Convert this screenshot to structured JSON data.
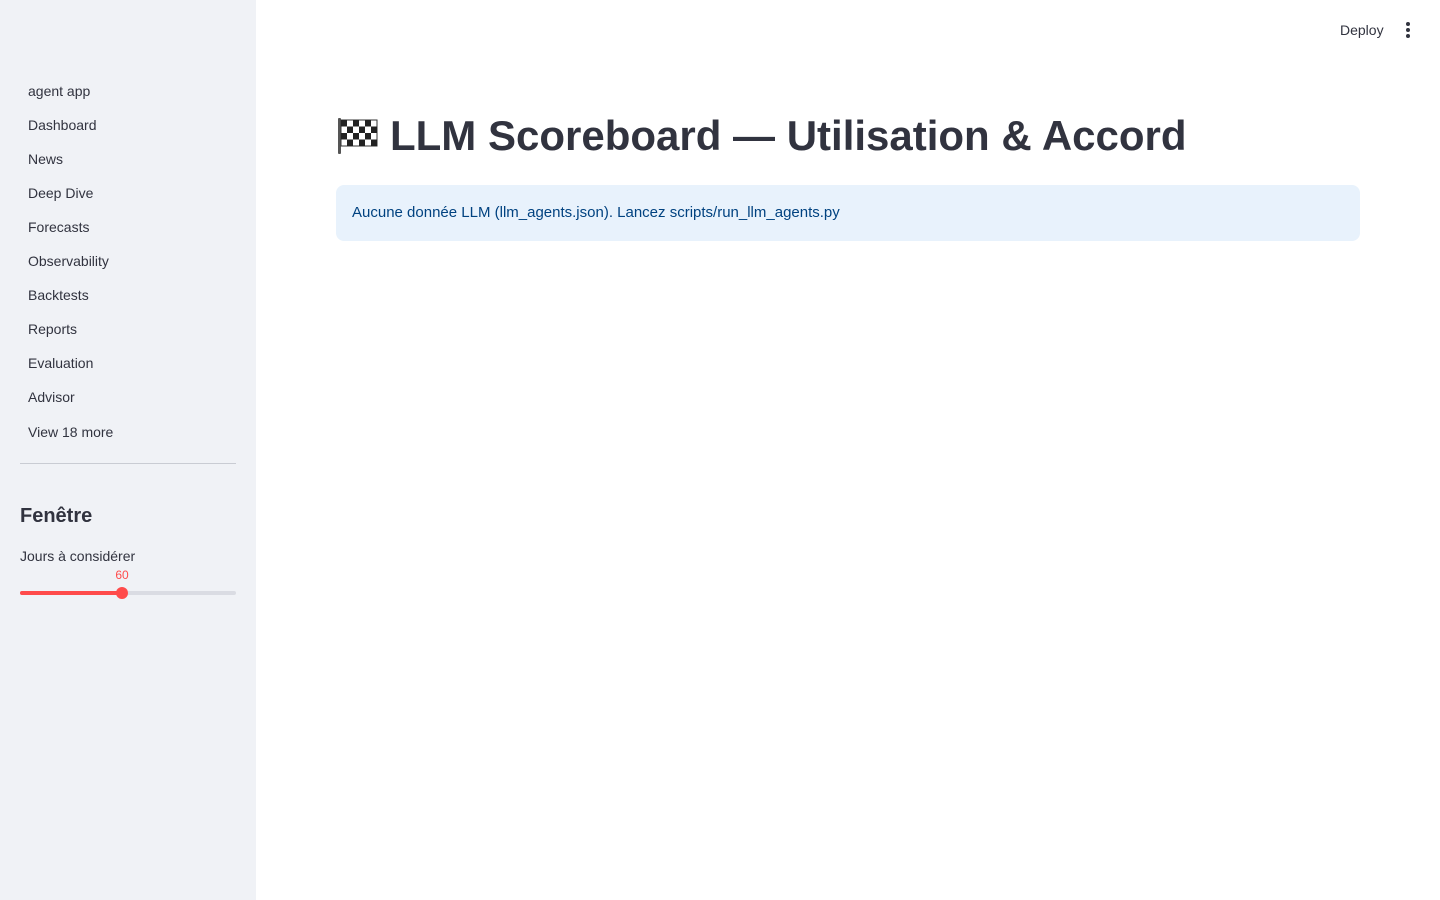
{
  "header": {
    "deploy_label": "Deploy",
    "menu_icon": "more-vert-icon"
  },
  "sidebar": {
    "items": [
      {
        "label": "agent app"
      },
      {
        "label": "Dashboard"
      },
      {
        "label": "News"
      },
      {
        "label": "Deep Dive"
      },
      {
        "label": "Forecasts"
      },
      {
        "label": "Observability"
      },
      {
        "label": "Backtests"
      },
      {
        "label": "Reports"
      },
      {
        "label": "Evaluation"
      },
      {
        "label": "Advisor"
      }
    ],
    "view_more_label": "View 18 more",
    "section_title": "Fenêtre",
    "slider": {
      "label": "Jours à considérer",
      "value": "60",
      "fraction": 0.47,
      "accent_color": "#ff4b4b"
    }
  },
  "main": {
    "title_icon": "checkered-flag-icon",
    "title": "LLM Scoreboard — Utilisation & Accord",
    "info_message": "Aucune donnée LLM (llm_agents.json). Lancez scripts/run_llm_agents.py"
  }
}
